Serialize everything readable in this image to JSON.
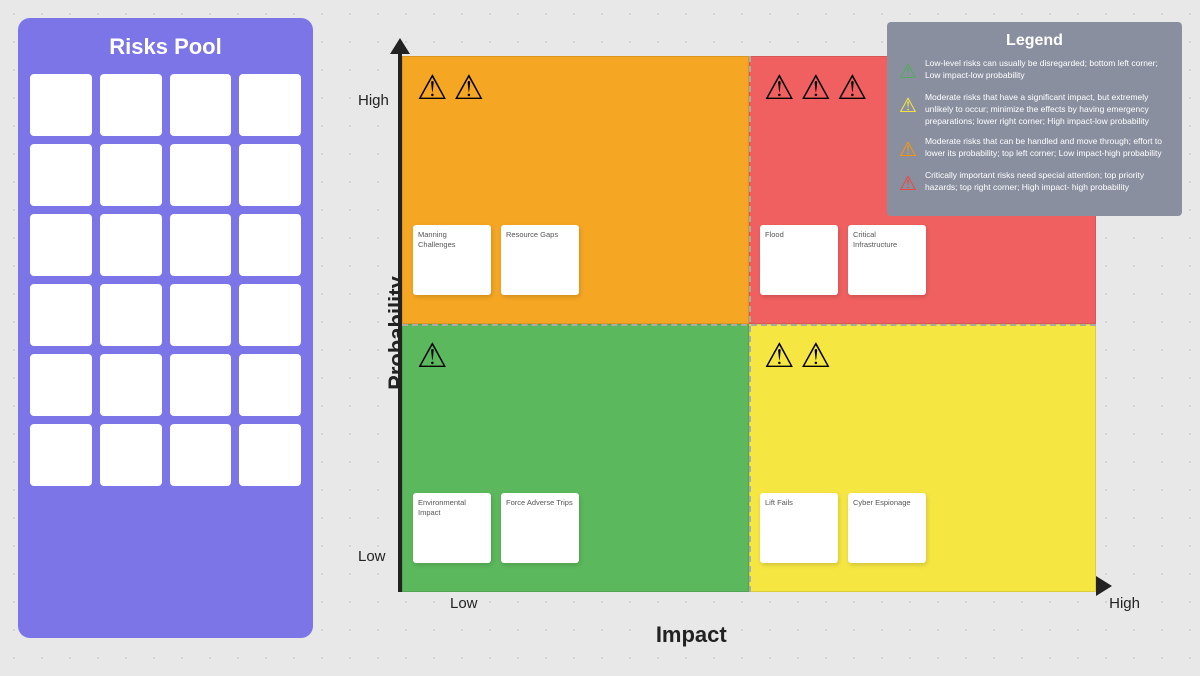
{
  "risksPool": {
    "title": "Risks Pool",
    "cards": [
      {
        "label": ""
      },
      {
        "label": ""
      },
      {
        "label": ""
      },
      {
        "label": ""
      },
      {
        "label": ""
      },
      {
        "label": ""
      },
      {
        "label": ""
      },
      {
        "label": ""
      },
      {
        "label": ""
      },
      {
        "label": ""
      },
      {
        "label": ""
      },
      {
        "label": ""
      },
      {
        "label": ""
      },
      {
        "label": ""
      },
      {
        "label": ""
      },
      {
        "label": ""
      },
      {
        "label": ""
      },
      {
        "label": ""
      },
      {
        "label": ""
      },
      {
        "label": ""
      },
      {
        "label": ""
      },
      {
        "label": ""
      },
      {
        "label": ""
      },
      {
        "label": ""
      }
    ]
  },
  "matrix": {
    "xAxisLabel": "Impact",
    "yAxisLabel": "Probability",
    "highY": "High",
    "lowY": "Low",
    "lowX": "Low",
    "highX": "High",
    "quadrants": {
      "topLeft": {
        "color": "orange",
        "warnCount": 2,
        "notes": [
          {
            "label": "Manning Challenges"
          },
          {
            "label": "Resource Gaps"
          }
        ]
      },
      "topRight": {
        "color": "red",
        "warnCount": 3,
        "notes": [
          {
            "label": "Flood"
          },
          {
            "label": "Critical Infrastructure"
          }
        ]
      },
      "bottomLeft": {
        "color": "green",
        "warnCount": 1,
        "notes": [
          {
            "label": "Environmental Impact"
          },
          {
            "label": "Force Adverse Trips"
          }
        ]
      },
      "bottomRight": {
        "color": "yellow",
        "warnCount": 2,
        "notes": [
          {
            "label": "Lift Fails"
          },
          {
            "label": "Cyber Espionage"
          }
        ]
      }
    }
  },
  "legend": {
    "title": "Legend",
    "items": [
      {
        "iconColor": "green",
        "iconType": "warning",
        "text": "Low-level risks can usually be disregarded; bottom left corner; Low impact-low probability"
      },
      {
        "iconColor": "yellow",
        "iconType": "warning",
        "text": "Moderate risks that have a significant impact, but extremely unlikely to occur; minimize the effects by having emergency preparations; lower right corner; High impact-low probability"
      },
      {
        "iconColor": "orange",
        "iconType": "warning",
        "text": "Moderate risks that can be handled and move through; effort to lower its probability; top left corner; Low impact-high probability"
      },
      {
        "iconColor": "red",
        "iconType": "warning",
        "text": "Critically important risks need special attention; top priority hazards; top right corner; High impact- high probability"
      }
    ]
  }
}
